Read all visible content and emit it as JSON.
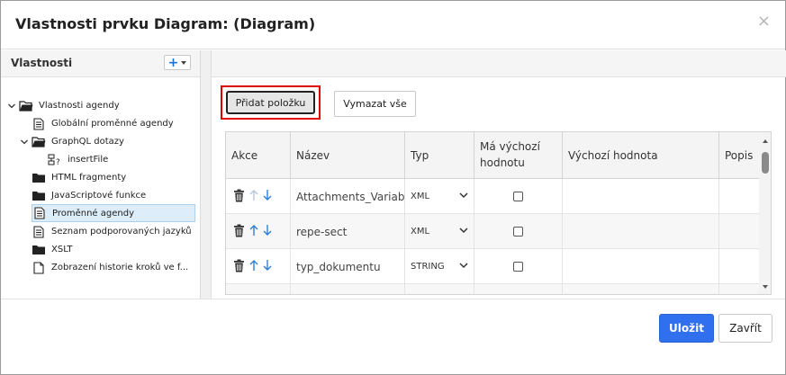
{
  "dialog": {
    "title": "Vlastnosti prvku Diagram: (Diagram)",
    "close_glyph": "×"
  },
  "left_panel": {
    "title": "Vlastnosti",
    "add_glyph": "+",
    "tree": [
      {
        "label": "Vlastnosti agendy",
        "icon": "folder-open-icon",
        "expanded": true
      },
      {
        "label": "Globální proměnné agendy",
        "icon": "variables-doc-icon"
      },
      {
        "label": "GraphQL dotazy",
        "icon": "folder-open-icon",
        "expanded": true
      },
      {
        "label": "insertFile",
        "icon": "query-icon"
      },
      {
        "label": "HTML fragmenty",
        "icon": "folder-icon"
      },
      {
        "label": "JavaScriptové funkce",
        "icon": "folder-icon"
      },
      {
        "label": "Proměnné agendy",
        "icon": "variables-doc-icon",
        "selected": true
      },
      {
        "label": "Seznam podporovaných jazyků",
        "icon": "variables-doc-icon"
      },
      {
        "label": "XSLT",
        "icon": "folder-icon"
      },
      {
        "label": "Zobrazení historie kroků ve f...",
        "icon": "document-icon"
      }
    ]
  },
  "toolbar": {
    "add_item_label": "Přidat položku",
    "clear_all_label": "Vymazat vše"
  },
  "grid": {
    "columns": {
      "actions": "Akce",
      "name": "Název",
      "type": "Typ",
      "has_default": "Má výchozí hodnotu",
      "default_value": "Výchozí hodnota",
      "description": "Popis"
    },
    "rows": [
      {
        "name": "Attachments_Variab",
        "type": "XML",
        "has_default": false
      },
      {
        "name": "repe-sect",
        "type": "XML",
        "has_default": false
      },
      {
        "name": "typ_dokumentu",
        "type": "STRING",
        "has_default": false
      },
      {
        "name": "",
        "type": "",
        "has_default": false
      }
    ]
  },
  "footer": {
    "save_label": "Uložit",
    "close_label": "Zavřít"
  },
  "colors": {
    "primary": "#3070ee",
    "highlight": "#e00000",
    "selected_bg": "#ddeefa",
    "arrow_blue": "#2f7fd8"
  }
}
